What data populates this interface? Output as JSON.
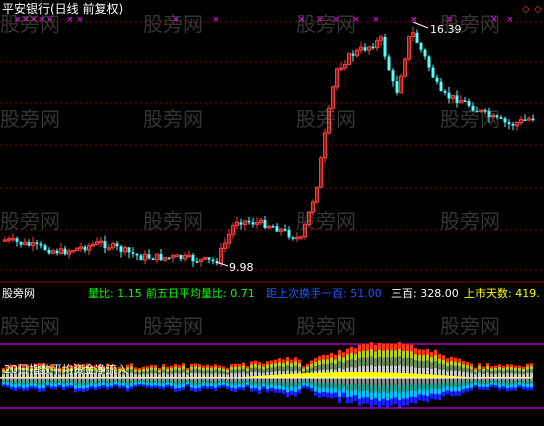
{
  "title": "平安银行(日线 前复权)",
  "diamonds": [
    "◇",
    "◇"
  ],
  "price_high_label": "16.39",
  "price_low_label": "9.98",
  "indicator_name": "股旁网",
  "stats": {
    "liangbi_label": "量比: 1.15",
    "avg5_label": "前五日平均量比: 0.71",
    "turnover_label": "距上次换手一百: 51.00",
    "sanbai_label": "三百: 328.00",
    "days_label": "上市天数: 419."
  },
  "flow_label": "20日指数平均资金净流入",
  "watermark": "股旁网",
  "colors": {
    "bg": "#000000",
    "grid": "#8b0000",
    "up": "#ff3b3b",
    "down": "#54ffff",
    "title": "#ffffff",
    "marker": "#ff00ff",
    "liangbi": "#00ff00",
    "avg5": "#00ff00",
    "turnover": "#0033ff",
    "sanbai": "#ffffff",
    "days": "#ffff00",
    "flow_line": "#ff00ff"
  }
}
